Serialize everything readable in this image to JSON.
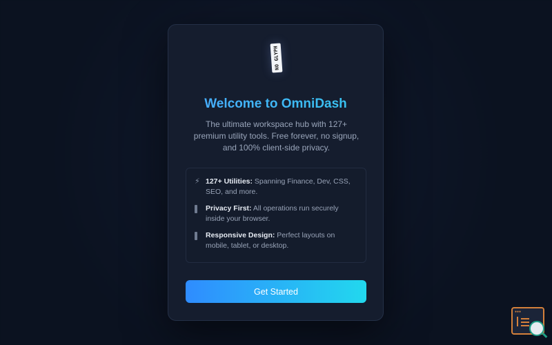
{
  "modal": {
    "brand_tag": "NO GLYPH",
    "title": "Welcome to OmniDash",
    "subtitle": "The ultimate workspace hub with 127+ premium utility tools. Free forever, no signup, and 100% client-side privacy.",
    "features": [
      {
        "icon": "lightning-icon",
        "glyph": "⚡",
        "title": "127+ Utilities:",
        "text": " Spanning Finance, Dev, CSS, SEO, and more."
      },
      {
        "icon": "shield-icon",
        "glyph": "",
        "title": "Privacy First:",
        "text": " All operations run securely inside your browser."
      },
      {
        "icon": "device-icon",
        "glyph": "",
        "title": "Responsive Design:",
        "text": " Perfect layouts on mobile, tablet, or desktop."
      }
    ],
    "cta_label": "Get Started"
  },
  "colors": {
    "accent_start": "#2f8cff",
    "accent_end": "#22d8ee",
    "widget_accent": "#d5813b"
  }
}
